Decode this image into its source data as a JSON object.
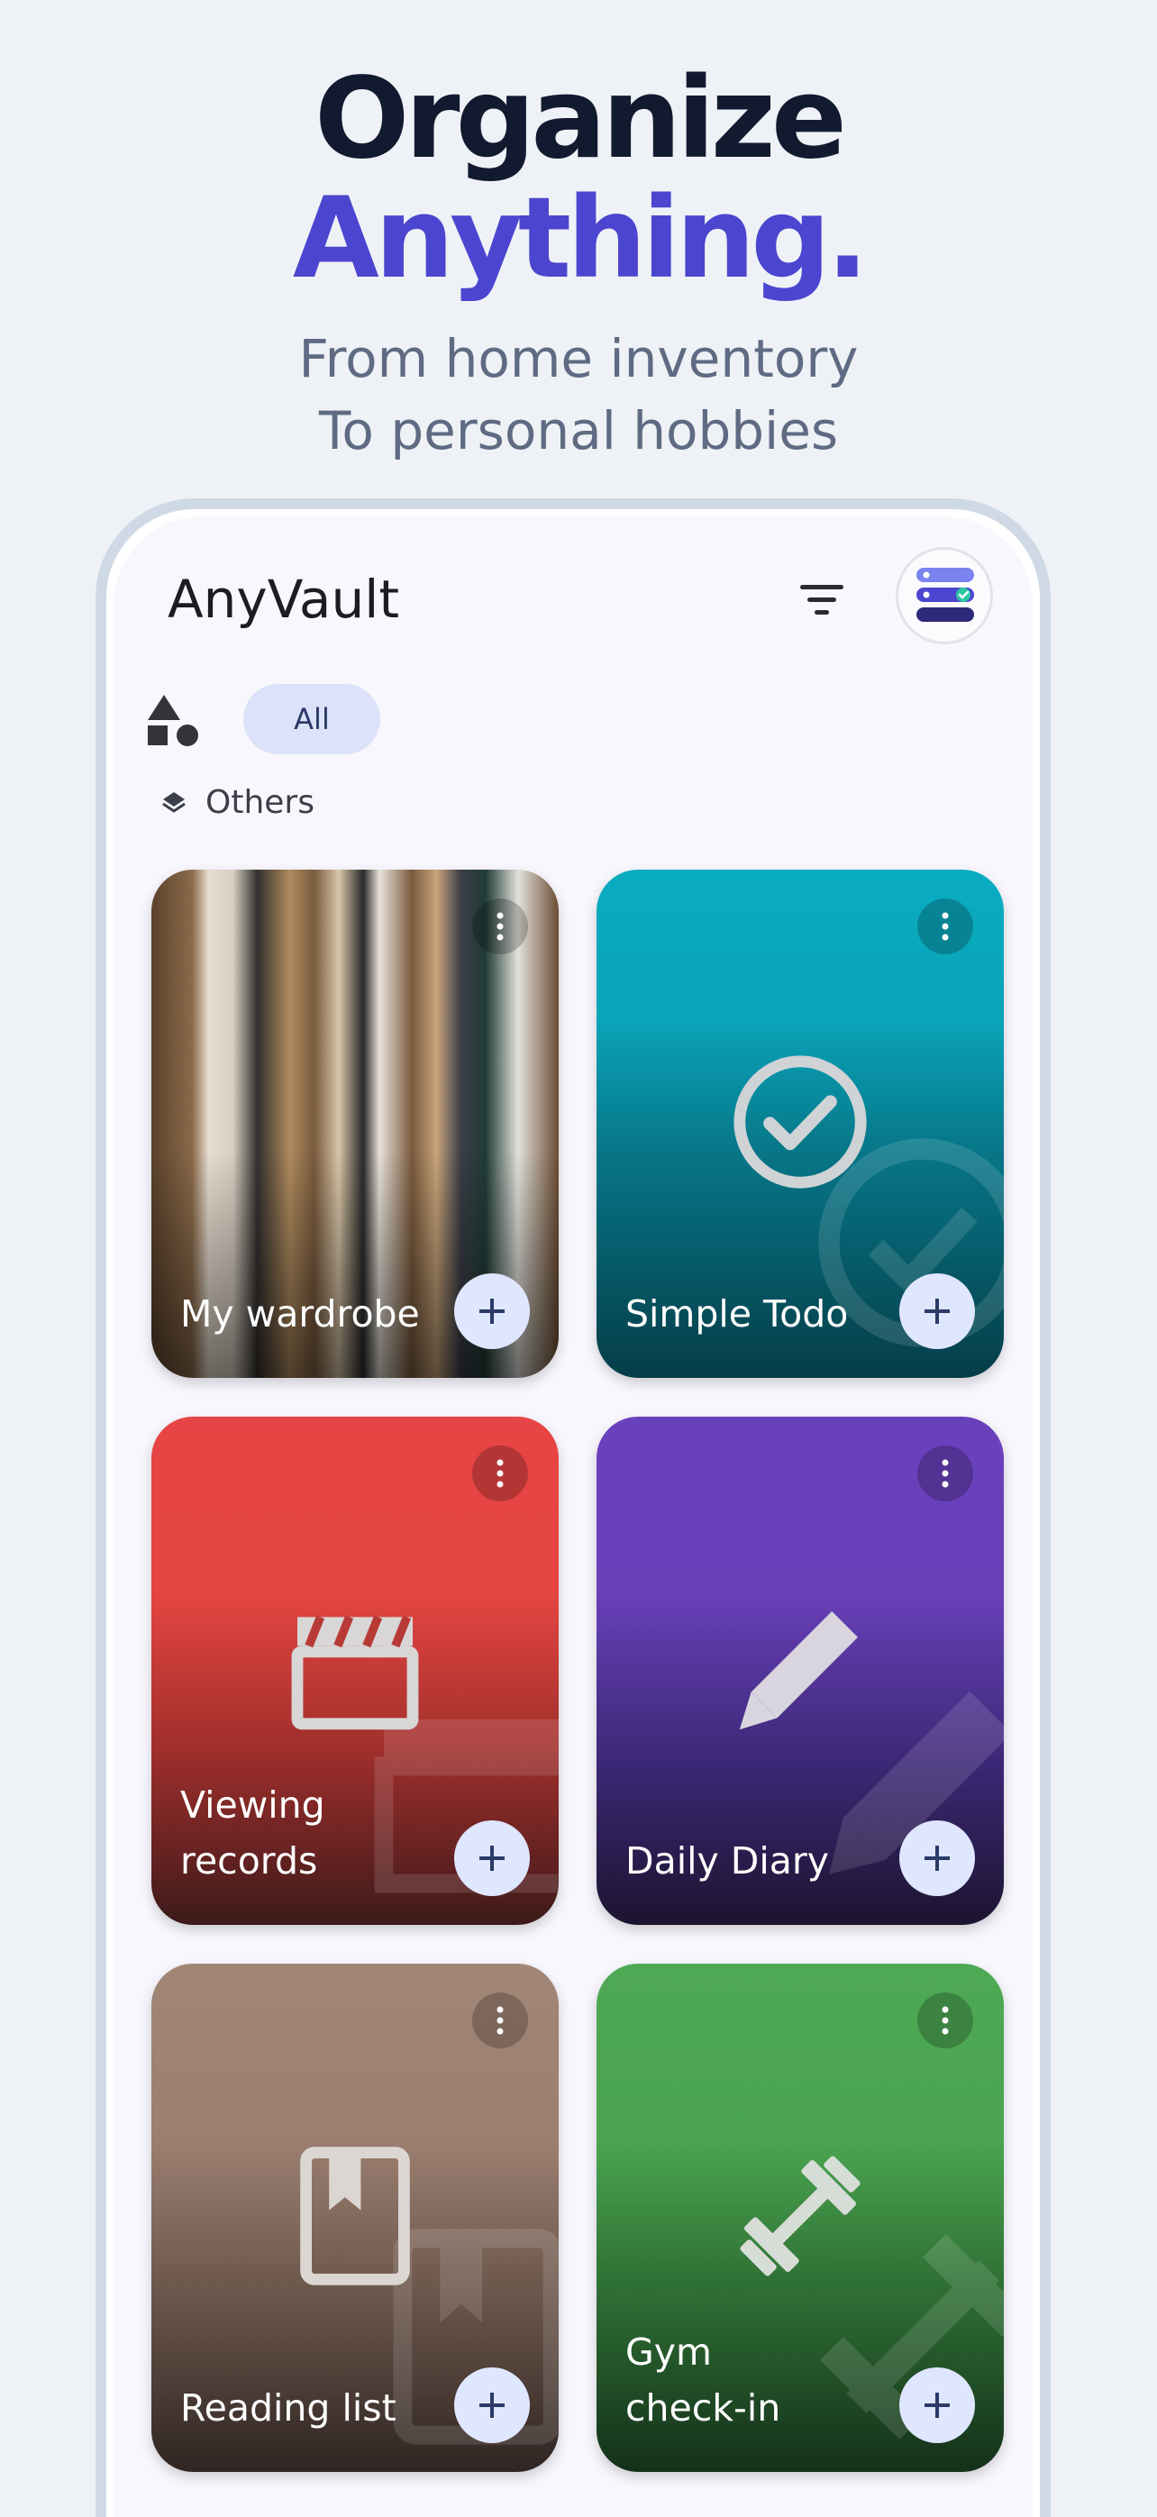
{
  "hero": {
    "line1": "Organize",
    "line2": "Anything.",
    "sub1": "From home inventory",
    "sub2": "To personal hobbies"
  },
  "app": {
    "title": "AnyVault",
    "filter_chip": "All",
    "section": "Others"
  },
  "cards": [
    {
      "title": "My wardrobe",
      "icon": "wardrobe-photo"
    },
    {
      "title": "Simple Todo",
      "icon": "check-circle-icon"
    },
    {
      "title": "Viewing records",
      "icon": "clapperboard-icon"
    },
    {
      "title": "Daily Diary",
      "icon": "pencil-icon"
    },
    {
      "title": "Reading list",
      "icon": "book-icon"
    },
    {
      "title": "Gym check-in",
      "icon": "dumbbell-icon"
    }
  ],
  "colors": {
    "accent": "#4b45cf",
    "todo": "#0aacc1",
    "viewing": "#e74545",
    "diary": "#6a41bd",
    "reading": "#a18676",
    "gym": "#4ea955",
    "add_button": "#dfe6ff"
  }
}
